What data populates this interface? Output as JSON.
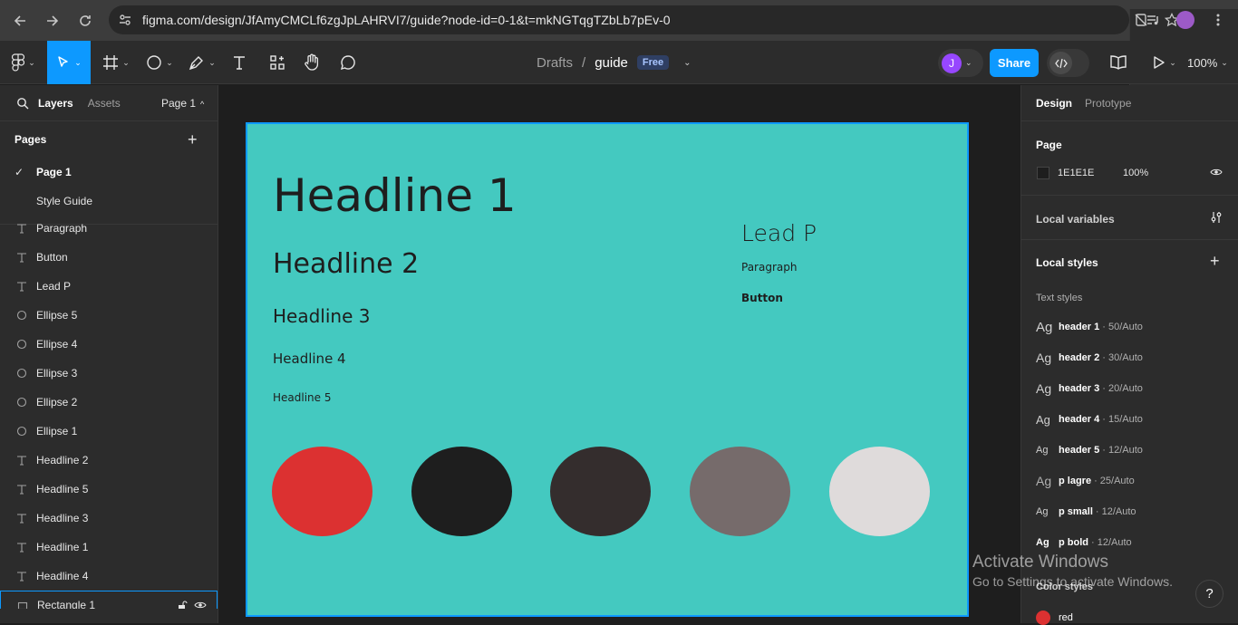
{
  "browser": {
    "url": "figma.com/design/JfAmyCMCLf6zgJpLAHRVI7/guide?node-id=0-1&t=mkNGTqgTZbLb7pEv-0"
  },
  "toolbar": {
    "breadcrumb_team": "Drafts",
    "breadcrumb_sep": "/",
    "file_name": "guide",
    "plan_badge": "Free",
    "user_initial": "J",
    "share_label": "Share",
    "zoom": "100%"
  },
  "left_panel": {
    "tab_layers": "Layers",
    "tab_assets": "Assets",
    "page_selector": "Page 1",
    "pages_title": "Pages",
    "pages": [
      {
        "label": "Page 1"
      },
      {
        "label": "Style Guide"
      }
    ],
    "layers": [
      {
        "label": "Paragraph",
        "icon": "text-icon"
      },
      {
        "label": "Button",
        "icon": "text-icon"
      },
      {
        "label": "Lead P",
        "icon": "text-icon"
      },
      {
        "label": "Ellipse 5",
        "icon": "ellipse-icon"
      },
      {
        "label": "Ellipse 4",
        "icon": "ellipse-icon"
      },
      {
        "label": "Ellipse 3",
        "icon": "ellipse-icon"
      },
      {
        "label": "Ellipse 2",
        "icon": "ellipse-icon"
      },
      {
        "label": "Ellipse 1",
        "icon": "ellipse-icon"
      },
      {
        "label": "Headline 2",
        "icon": "text-icon"
      },
      {
        "label": "Headline 5",
        "icon": "text-icon"
      },
      {
        "label": "Headline 3",
        "icon": "text-icon"
      },
      {
        "label": "Headline 1",
        "icon": "text-icon"
      },
      {
        "label": "Headline 4",
        "icon": "text-icon"
      },
      {
        "label": "Rectangle 1",
        "icon": "rectangle-icon"
      }
    ]
  },
  "canvas": {
    "frame_color": "#44c9c0",
    "headline1": "Headline 1",
    "headline2": "Headline 2",
    "headline3": "Headline 3",
    "headline4": "Headline 4",
    "headline5": "Headline 5",
    "lead_p": "Lead P",
    "paragraph": "Paragraph",
    "button": "Button",
    "ellipse_colors": [
      "#dc3131",
      "#1e1e1e",
      "#342d2d",
      "#766b6b",
      "#dfdbdb"
    ]
  },
  "right_panel": {
    "tab_design": "Design",
    "tab_prototype": "Prototype",
    "page_section_title": "Page",
    "page_color_hex": "1E1E1E",
    "page_opacity": "100%",
    "local_variables": "Local variables",
    "local_styles": "Local styles",
    "text_styles_label": "Text styles",
    "text_styles": [
      {
        "name": "header 1",
        "size": "· 50/Auto"
      },
      {
        "name": "header 2",
        "size": "· 30/Auto"
      },
      {
        "name": "header 3",
        "size": "· 20/Auto"
      },
      {
        "name": "header 4",
        "size": "· 15/Auto"
      },
      {
        "name": "header 5",
        "size": "· 12/Auto"
      },
      {
        "name": "p lagre",
        "size": "· 25/Auto"
      },
      {
        "name": "p small",
        "size": "· 12/Auto"
      },
      {
        "name": "p bold",
        "size": "· 12/Auto"
      }
    ],
    "ag_label": "Ag",
    "color_styles_label": "Color styles",
    "color_styles": [
      {
        "name": "red",
        "color": "#dc3131"
      }
    ]
  },
  "overlay": {
    "activate_title": "Activate Windows",
    "activate_sub": "Go to Settings to activate Windows.",
    "help": "?"
  }
}
